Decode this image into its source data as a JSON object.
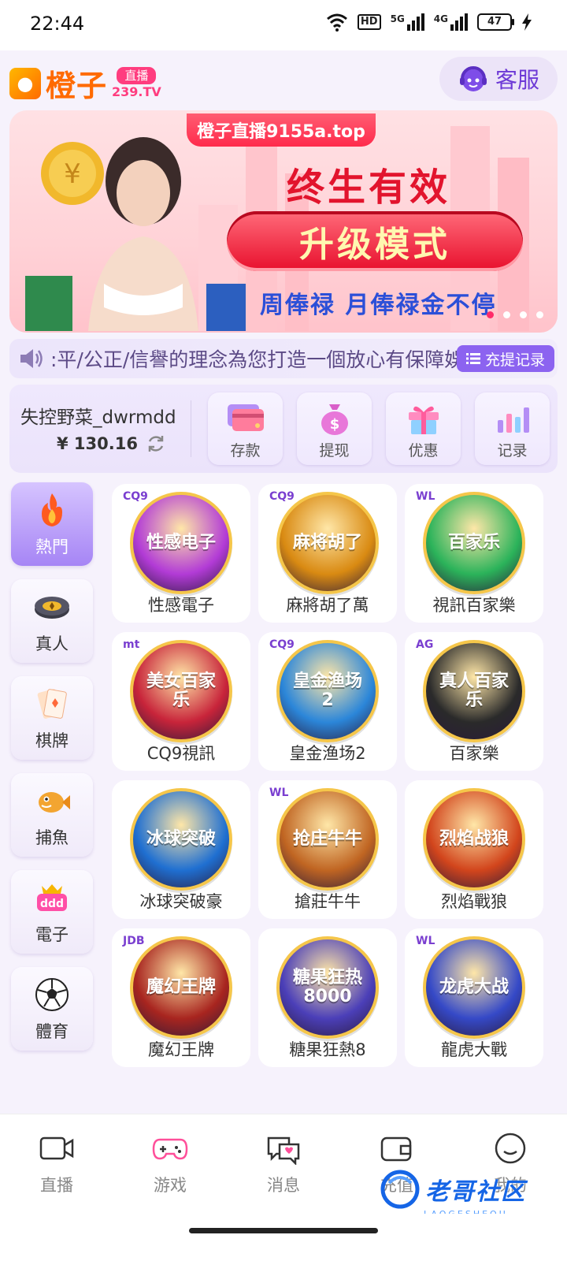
{
  "status": {
    "time": "22:44",
    "hd": "HD",
    "sig1": "5G",
    "sig2": "4G",
    "battery": "47"
  },
  "header": {
    "logo_name": "橙子",
    "logo_tag_top": "直播",
    "logo_tag_bottom": "239.TV",
    "service_label": "客服"
  },
  "banner": {
    "url": "橙子直播9155a.top",
    "headline": "终生有效",
    "pill": "升级模式",
    "sub": "周俸禄 月俸禄金不停"
  },
  "notice": {
    "text": ":平/公正/信譽的理念為您打造一個放心有保障娛",
    "button": "充提记录"
  },
  "wallet": {
    "username": "失控野菜_dwrmdd",
    "balance": "¥ 130.16",
    "actions": [
      {
        "label": "存款"
      },
      {
        "label": "提现"
      },
      {
        "label": "优惠"
      },
      {
        "label": "记录"
      }
    ]
  },
  "sidebar": {
    "items": [
      {
        "label": "熱門"
      },
      {
        "label": "真人"
      },
      {
        "label": "棋牌"
      },
      {
        "label": "捕魚"
      },
      {
        "label": "電子"
      },
      {
        "label": "體育"
      }
    ]
  },
  "games": [
    {
      "name": "性感電子",
      "brand": "CQ9",
      "art": "性感电子",
      "color": "#b23bd6"
    },
    {
      "name": "麻將胡了萬",
      "brand": "CQ9",
      "art": "麻将胡了",
      "color": "#d98a12"
    },
    {
      "name": "視訊百家樂",
      "brand": "WL",
      "art": "百家乐",
      "color": "#2bb35a"
    },
    {
      "name": "CQ9視訊",
      "brand": "mt",
      "art": "美女百家乐",
      "color": "#c8243a"
    },
    {
      "name": "皇金渔场2",
      "brand": "CQ9",
      "art": "皇金渔场2",
      "color": "#2b86d9"
    },
    {
      "name": "百家樂",
      "brand": "AG",
      "art": "真人百家乐",
      "color": "#2a2a2a"
    },
    {
      "name": "冰球突破豪",
      "brand": "",
      "art": "冰球突破",
      "color": "#1f6fd1"
    },
    {
      "name": "搶莊牛牛",
      "brand": "WL",
      "art": "抢庄牛牛",
      "color": "#c06522"
    },
    {
      "name": "烈焰戰狼",
      "brand": "",
      "art": "烈焰战狼",
      "color": "#d2451c"
    },
    {
      "name": "魔幻王牌",
      "brand": "JDB",
      "art": "魔幻王牌",
      "color": "#a8251f"
    },
    {
      "name": "糖果狂熱8",
      "brand": "",
      "art": "糖果狂热8000",
      "color": "#4b3fb8"
    },
    {
      "name": "龍虎大戰",
      "brand": "WL",
      "art": "龙虎大战",
      "color": "#3549c7"
    }
  ],
  "tabs": [
    {
      "label": "直播"
    },
    {
      "label": "游戏"
    },
    {
      "label": "消息"
    },
    {
      "label": "充值"
    },
    {
      "label": "我的"
    }
  ],
  "watermark": {
    "text": "老哥社区",
    "sub": "LAOGESHEQU"
  },
  "colors": {
    "accent": "#8c63f0",
    "brand": "#ff6a00",
    "banner_red": "#e2142d"
  }
}
